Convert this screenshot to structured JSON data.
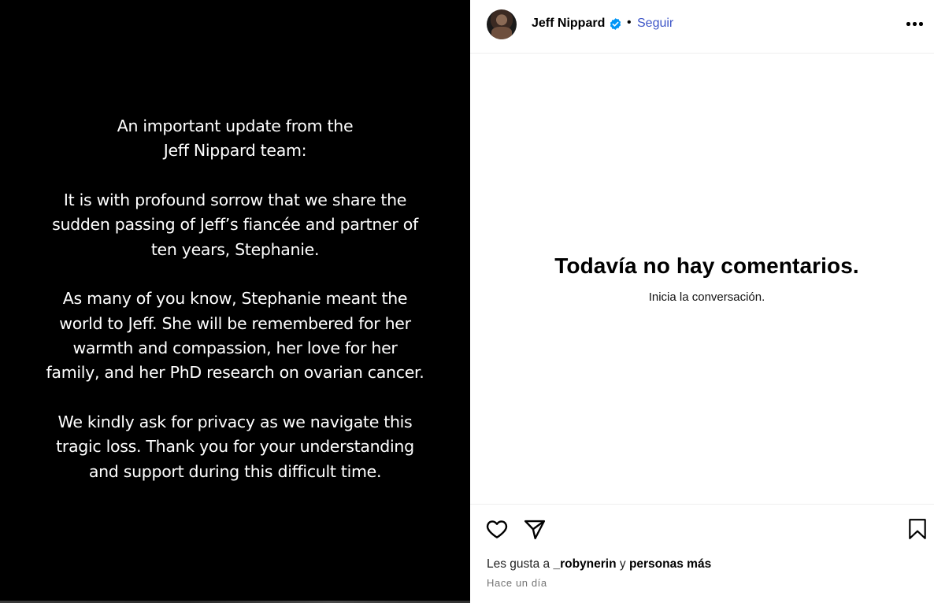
{
  "post": {
    "paragraphs": [
      "An important update from the\nJeff Nippard team:",
      "It is with profound sorrow that we share the\nsudden passing of Jeff’s fiancée and partner of\nten years, Stephanie.",
      "As many of you know, Stephanie meant the\nworld to Jeff. She will be remembered for her\nwarmth and compassion, her love for her\nfamily, and her PhD research on ovarian cancer.",
      "We kindly ask for privacy as we navigate this\ntragic loss. Thank you for your understanding\nand support during this difficult time."
    ]
  },
  "header": {
    "username": "Jeff Nippard",
    "separator": "•",
    "follow_label": "Seguir",
    "verified_icon": "verified-badge-icon",
    "more_icon": "more-options-icon"
  },
  "comments": {
    "empty_title": "Todavía no hay comentarios.",
    "empty_subtitle": "Inicia la conversación."
  },
  "actions": {
    "like_icon": "heart-icon",
    "share_icon": "paper-plane-icon",
    "save_icon": "bookmark-icon",
    "likes_prefix": "Les gusta a ",
    "liker": "_robynerin",
    "likes_connector": " y ",
    "likes_others": "personas más",
    "timestamp": "Hace un día"
  },
  "colors": {
    "follow": "#3d55c7",
    "verified": "#0095f6",
    "image_background": "#000000"
  }
}
